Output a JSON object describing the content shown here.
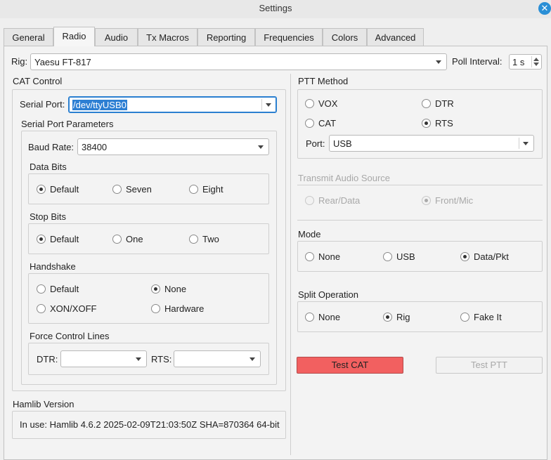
{
  "window": {
    "title": "Settings",
    "close_icon": "close-icon"
  },
  "tabs": [
    {
      "label": "General",
      "active": false
    },
    {
      "label": "Radio",
      "active": true
    },
    {
      "label": "Audio",
      "active": false
    },
    {
      "label": "Tx Macros",
      "active": false
    },
    {
      "label": "Reporting",
      "active": false
    },
    {
      "label": "Frequencies",
      "active": false
    },
    {
      "label": "Colors",
      "active": false
    },
    {
      "label": "Advanced",
      "active": false
    }
  ],
  "rig": {
    "label": "Rig:",
    "value": "Yaesu FT-817",
    "poll_label": "Poll Interval:",
    "poll_value": "1 s"
  },
  "cat": {
    "title": "CAT Control",
    "serial_port_label": "Serial Port:",
    "serial_port_value": "/dev/ttyUSB0",
    "params_title": "Serial Port Parameters",
    "baud_label": "Baud Rate:",
    "baud_value": "38400",
    "data_bits": {
      "title": "Data Bits",
      "options": [
        "Default",
        "Seven",
        "Eight"
      ],
      "selected": "Default"
    },
    "stop_bits": {
      "title": "Stop Bits",
      "options": [
        "Default",
        "One",
        "Two"
      ],
      "selected": "Default"
    },
    "handshake": {
      "title": "Handshake",
      "options": [
        "Default",
        "None",
        "XON/XOFF",
        "Hardware"
      ],
      "selected": "None"
    },
    "force": {
      "title": "Force Control Lines",
      "dtr_label": "DTR:",
      "dtr_value": "",
      "rts_label": "RTS:",
      "rts_value": ""
    }
  },
  "hamlib": {
    "title": "Hamlib Version",
    "text": "In use:  Hamlib 4.6.2 2025-02-09T21:03:50Z SHA=870364 64-bit"
  },
  "ptt": {
    "title": "PTT Method",
    "options": [
      "VOX",
      "DTR",
      "CAT",
      "RTS"
    ],
    "selected": "RTS",
    "port_label": "Port:",
    "port_value": "USB"
  },
  "tx_audio": {
    "title": "Transmit Audio Source",
    "options": [
      "Rear/Data",
      "Front/Mic"
    ],
    "selected": "Front/Mic",
    "enabled": false
  },
  "mode": {
    "title": "Mode",
    "options": [
      "None",
      "USB",
      "Data/Pkt"
    ],
    "selected": "Data/Pkt"
  },
  "split": {
    "title": "Split Operation",
    "options": [
      "None",
      "Rig",
      "Fake It"
    ],
    "selected": "Rig"
  },
  "buttons": {
    "test_cat": "Test CAT",
    "test_ptt": "Test PTT"
  },
  "colors": {
    "accent": "#2d7fd3",
    "test_cat_bg": "#f26060"
  }
}
